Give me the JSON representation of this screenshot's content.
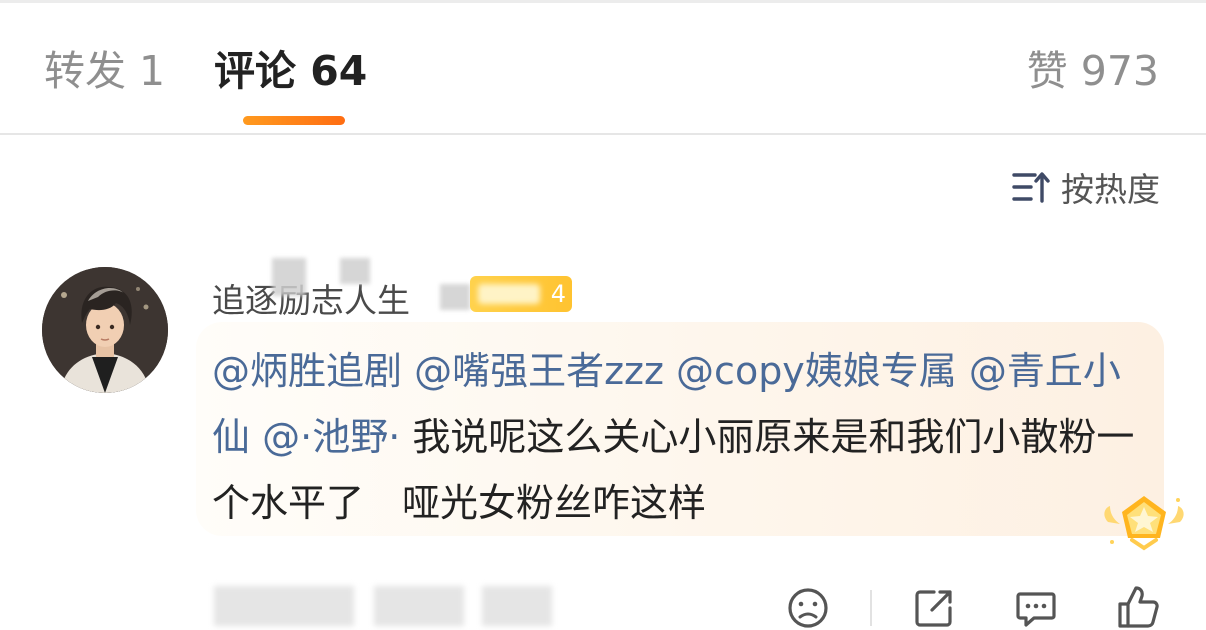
{
  "tabs": {
    "repost": {
      "label": "转发",
      "count": "1"
    },
    "comments": {
      "label": "评论",
      "count": "64"
    },
    "likes": {
      "label": "赞",
      "count": "973"
    }
  },
  "sort": {
    "label": "按热度",
    "icon": "sort-icon"
  },
  "comment": {
    "username": "追逐励志人生",
    "fan_badge_level": "4",
    "mentions": [
      "@炳胜追剧",
      "@嘴强王者zzz",
      "@copy姨娘专属",
      "@青丘小仙",
      "@·池野·"
    ],
    "text": "我说呢这么关心小丽原来是和我们小散粉一个水平了　哑光女粉丝咋这样",
    "badge_icon": "gold-star-badge-icon"
  },
  "actions": {
    "icons": [
      "dislike-face-icon",
      "share-icon",
      "reply-icon",
      "like-icon"
    ]
  },
  "colors": {
    "accent": "#ff7d17",
    "mention": "#4a6a98",
    "fan_badge": "#ffc330"
  }
}
